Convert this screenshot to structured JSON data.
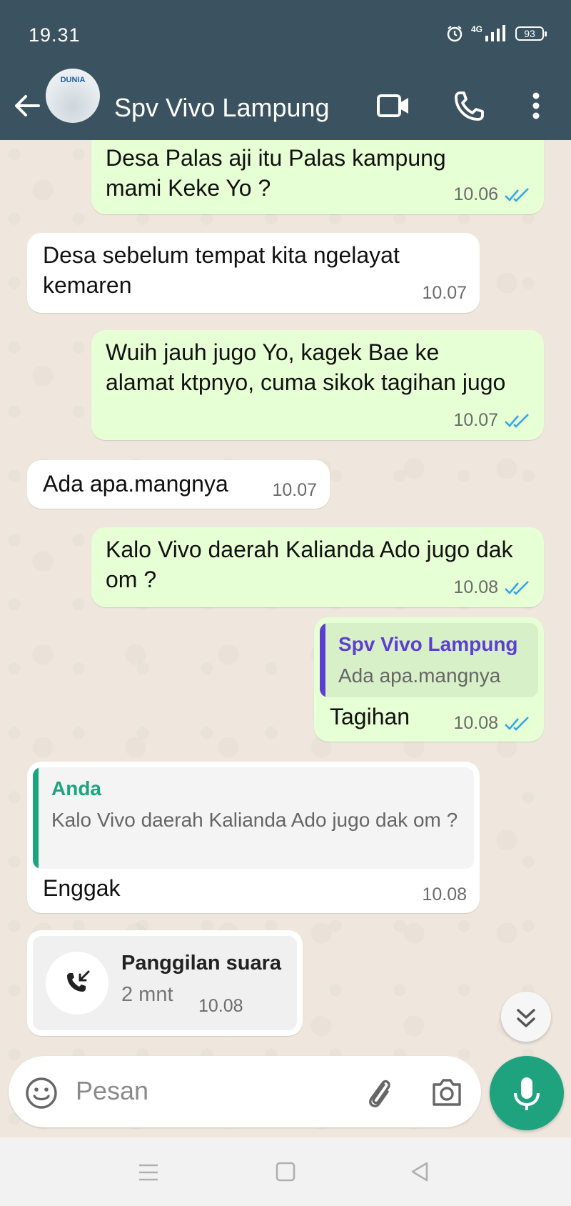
{
  "status_bar": {
    "time": "19.31",
    "network": "4G",
    "battery": "93"
  },
  "header": {
    "contact_name": "Spv Vivo Lampung",
    "avatar_text": "DUNIA"
  },
  "messages": [
    {
      "id": "m1",
      "direction": "outgoing",
      "text": "Desa Palas aji itu Palas kampung mami Keke Yo ?",
      "time": "10.06",
      "status": "read"
    },
    {
      "id": "m2",
      "direction": "incoming",
      "text": "Desa sebelum tempat kita ngelayat kemaren",
      "time": "10.07"
    },
    {
      "id": "m3",
      "direction": "outgoing",
      "text": "Wuih jauh jugo Yo, kagek Bae ke alamat ktpnyo, cuma sikok tagihan jugo",
      "time": "10.07",
      "status": "read"
    },
    {
      "id": "m4",
      "direction": "incoming",
      "text": "Ada apa.mangnya",
      "time": "10.07"
    },
    {
      "id": "m5",
      "direction": "outgoing",
      "text": "Kalo Vivo daerah Kalianda Ado jugo dak om ?",
      "time": "10.08",
      "status": "read"
    },
    {
      "id": "m6",
      "direction": "outgoing",
      "text": "Tagihan",
      "time": "10.08",
      "status": "read",
      "quote": {
        "author": "Spv Vivo Lampung",
        "text": "Ada apa.mangnya",
        "color": "#5b3fd1"
      }
    },
    {
      "id": "m7",
      "direction": "incoming",
      "text": "Enggak",
      "time": "10.08",
      "quote": {
        "author": "Anda",
        "text": "Kalo Vivo daerah Kalianda Ado jugo dak om ?",
        "color": "#1aa57e"
      }
    },
    {
      "id": "m8",
      "direction": "incoming",
      "type": "voice-call",
      "title": "Panggilan suara",
      "duration": "2 mnt",
      "time": "10.08"
    }
  ],
  "composer": {
    "placeholder": "Pesan"
  },
  "colors": {
    "header_bg": "#3b5360",
    "outgoing_bubble": "#e7ffd4",
    "incoming_bubble": "#ffffff",
    "read_ticks": "#34a6e5",
    "accent": "#1fa37f"
  }
}
